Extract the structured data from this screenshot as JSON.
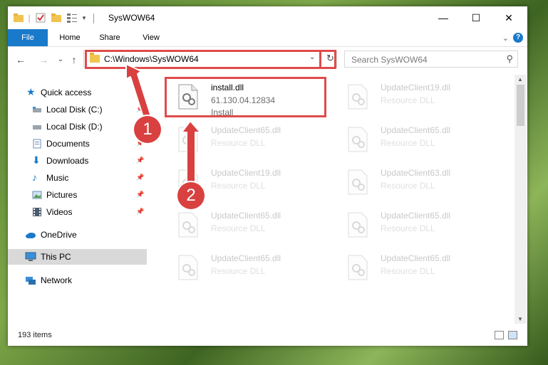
{
  "window": {
    "title": "SysWOW64",
    "minimize_glyph": "—",
    "maximize_glyph": "☐",
    "close_glyph": "✕"
  },
  "ribbon": {
    "tabs": [
      "File",
      "Home",
      "Share",
      "View"
    ],
    "help_glyph": "?"
  },
  "navigation": {
    "back_glyph": "←",
    "forward_glyph": "→",
    "recent_glyph": "⌄",
    "up_glyph": "↑"
  },
  "address_bar": {
    "path": "C:\\Windows\\SysWOW64",
    "dropdown_glyph": "⌄",
    "refresh_glyph": "↻"
  },
  "search": {
    "placeholder": "Search SysWOW64",
    "icon_glyph": "⚲"
  },
  "sidebar": {
    "items": [
      {
        "label": "Quick access",
        "icon": "star-icon"
      },
      {
        "label": "Local Disk (C:)",
        "icon": "drive-icon"
      },
      {
        "label": "Local Disk (D:)",
        "icon": "drive-icon"
      },
      {
        "label": "Documents",
        "icon": "documents-icon"
      },
      {
        "label": "Downloads",
        "icon": "downloads-icon"
      },
      {
        "label": "Music",
        "icon": "music-icon"
      },
      {
        "label": "Pictures",
        "icon": "pictures-icon"
      },
      {
        "label": "Videos",
        "icon": "videos-icon"
      },
      {
        "label": "OneDrive",
        "icon": "cloud-icon"
      },
      {
        "label": "This PC",
        "icon": "computer-icon"
      },
      {
        "label": "Network",
        "icon": "network-icon"
      }
    ],
    "pin_glyph": "📌"
  },
  "files": [
    {
      "name": "install.dll",
      "line2": "61.130.04.12834",
      "line3": "Install"
    },
    {
      "name": "UpdateClient19.dll",
      "line2": "Resource DLL"
    },
    {
      "name": "UpdateClient65.dll",
      "line2": "Resource DLL"
    },
    {
      "name": "UpdateClient65.dll",
      "line2": "Resource DLL"
    },
    {
      "name": "UpdateClient19.dll",
      "line2": "Resource DLL"
    },
    {
      "name": "UpdateClient63.dll",
      "line2": "Resource DLL"
    },
    {
      "name": "UpdateClient65.dll",
      "line2": "Resource DLL"
    },
    {
      "name": "UpdateClient65.dll",
      "line2": "Resource DLL"
    },
    {
      "name": "UpdateClient65.dll",
      "line2": "Resource DLL"
    },
    {
      "name": "UpdateClient65.dll",
      "line2": "Resource DLL"
    }
  ],
  "status_bar": {
    "item_count": "193 items"
  },
  "annotations": {
    "step1": "1",
    "step2": "2",
    "highlight_color": "#e04b4b"
  },
  "colors": {
    "accent": "#1979ca",
    "selected_nav": "#d9d9d9",
    "callout": "#d94040"
  }
}
